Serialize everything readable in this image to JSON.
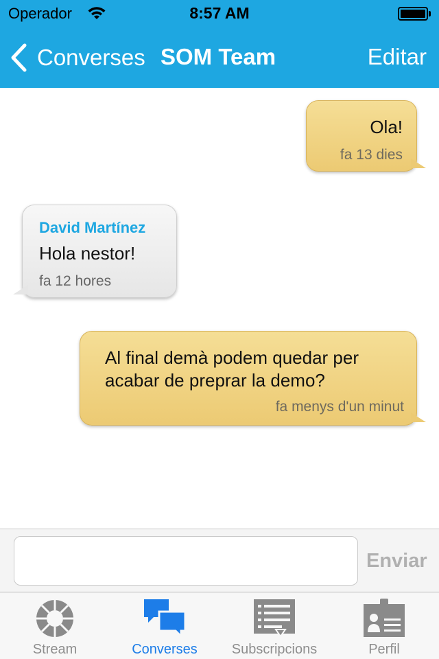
{
  "status_bar": {
    "carrier": "Operador",
    "time": "8:57 AM",
    "icons": [
      "wifi-icon",
      "battery-icon"
    ]
  },
  "nav": {
    "back_label": "Converses",
    "title": "SOM Team",
    "edit_label": "Editar",
    "color": "#1ea7e1"
  },
  "messages": [
    {
      "direction": "outgoing",
      "text": "Ola!",
      "time": "fa 13 dies"
    },
    {
      "direction": "incoming",
      "sender": "David Martínez",
      "text": "Hola nestor!",
      "time": "fa 12 hores"
    },
    {
      "direction": "outgoing",
      "text": "Al final demà podem quedar per acabar de preprar la demo?",
      "time": "fa menys d'un minut"
    }
  ],
  "composer": {
    "input_value": "",
    "send_label": "Enviar"
  },
  "tabs": [
    {
      "label": "Stream",
      "icon": "stream-icon",
      "active": false
    },
    {
      "label": "Converses",
      "icon": "chat-bubbles-icon",
      "active": true
    },
    {
      "label": "Subscripcions",
      "icon": "subscriptions-list-icon",
      "active": false
    },
    {
      "label": "Perfil",
      "icon": "profile-badge-icon",
      "active": false
    }
  ],
  "colors": {
    "accent": "#1ea7e1",
    "active_tab": "#1d7de8",
    "outgoing_bubble": "#ecca73",
    "incoming_bubble": "#e6e6e6"
  }
}
